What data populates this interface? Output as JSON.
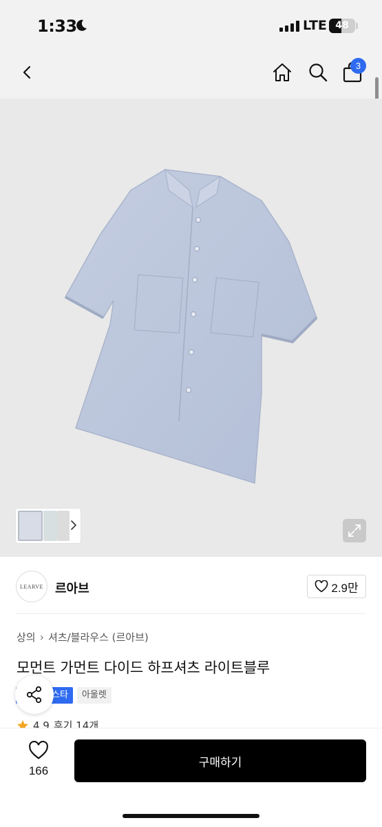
{
  "status_bar": {
    "time": "1:33",
    "network": "LTE",
    "battery": "48",
    "battery_level": 0.48,
    "icons": [
      "moon-icon",
      "signal-icon",
      "battery-icon"
    ]
  },
  "header": {
    "icons": [
      "back-icon",
      "home-icon",
      "search-icon",
      "bag-icon"
    ],
    "cart_count": "3",
    "accent_color": "#2f6bf0"
  },
  "gallery": {
    "thumbnail_count": 3,
    "icons": [
      "chevron-right-icon",
      "expand-icon"
    ]
  },
  "brand": {
    "logo_text": "LEARVE",
    "name": "르아브",
    "likes": "2.9만"
  },
  "product": {
    "breadcrumb": [
      "상의",
      "셔츠/블라우스 (르아브)"
    ],
    "title": "모먼트 가먼트 다이드 하프셔츠 라이트블루",
    "tags": [
      "스타",
      "아울렛"
    ],
    "rating": "4.9",
    "reviews": "후기 14개"
  },
  "bottom_bar": {
    "wish_count": "166",
    "buy_label": "구매하기"
  }
}
